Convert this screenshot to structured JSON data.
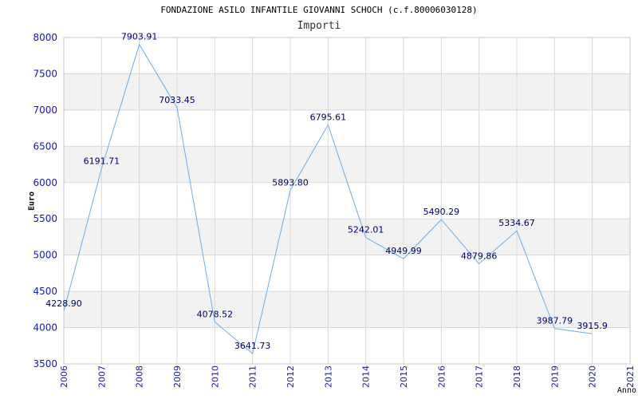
{
  "chart_data": {
    "type": "line",
    "title": "FONDAZIONE ASILO INFANTILE GIOVANNI SCHOCH (c.f.80006030128)",
    "subtitle": "Importi",
    "xlabel": "Anno",
    "ylabel": "Euro",
    "ylim": [
      3500,
      8000
    ],
    "yticks": [
      3500,
      4000,
      4500,
      5000,
      5500,
      6000,
      6500,
      7000,
      7500,
      8000
    ],
    "grid": true,
    "x": [
      2006,
      2007,
      2008,
      2009,
      2010,
      2011,
      2012,
      2013,
      2014,
      2015,
      2016,
      2017,
      2018,
      2019,
      2020,
      2021
    ],
    "series": [
      {
        "values": [
          4228.9,
          6191.71,
          7903.91,
          7033.45,
          4078.52,
          3641.73,
          5893.8,
          6795.61,
          5242.01,
          4949.99,
          5490.29,
          4879.86,
          5334.67,
          3987.79,
          3915.9,
          null
        ],
        "labels": [
          "4228.90",
          "6191.71",
          "7903.91",
          "7033.45",
          "4078.52",
          "3641.73",
          "5893.80",
          "6795.61",
          "5242.01",
          "4949.99",
          "5490.29",
          "4879.86",
          "5334.67",
          "3987.79",
          "3915.9",
          ""
        ]
      }
    ],
    "colors": {
      "line": "#6aaee8",
      "band": "#f2f2f2",
      "grid": "#d9d9d9",
      "axis_text": "#1a1aa6",
      "label_text": "#000066"
    }
  }
}
